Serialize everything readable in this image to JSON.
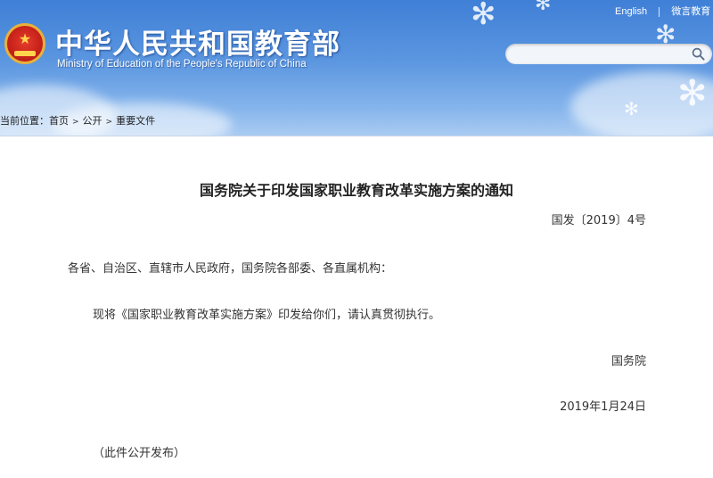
{
  "header": {
    "title_cn": "中华人民共和国教育部",
    "title_en": "Ministry of Education of the People's Republic of China",
    "links": {
      "english": "English",
      "weibo": "微言教育"
    },
    "search": {
      "placeholder": "",
      "icon": "search-icon"
    },
    "emblem": "national-emblem-icon"
  },
  "breadcrumb": {
    "prefix": "当前位置：",
    "items": [
      "首页",
      "公开",
      "重要文件"
    ]
  },
  "document": {
    "title": "国务院关于印发国家职业教育改革实施方案的通知",
    "number": "国发〔2019〕4号",
    "addressee": "各省、自治区、直辖市人民政府，国务院各部委、各直属机构：",
    "body": "现将《国家职业教育改革实施方案》印发给你们，请认真贯彻执行。",
    "signer": "国务院",
    "date": "2019年1月24日",
    "note": "（此件公开发布）"
  },
  "colors": {
    "header_blue": "#3f7fd6",
    "header_light": "#a9cbf2",
    "emblem_red": "#c8231b",
    "emblem_gold": "#e8b13a"
  }
}
